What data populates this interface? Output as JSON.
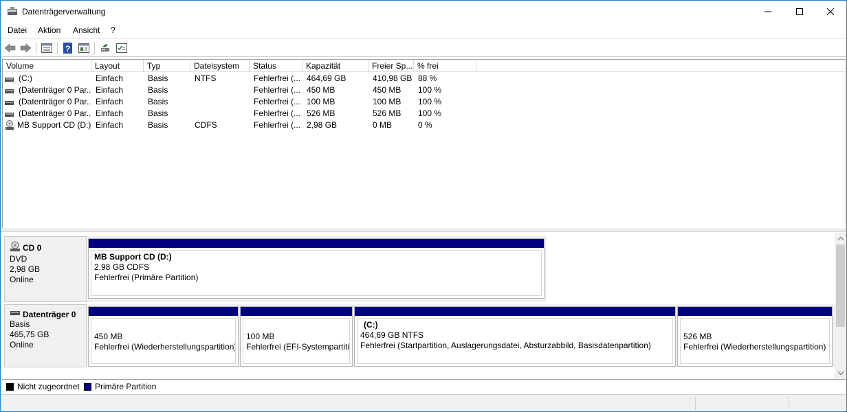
{
  "window": {
    "title": "Datenträgerverwaltung"
  },
  "menu": [
    "Datei",
    "Aktion",
    "Ansicht",
    "?"
  ],
  "toolbar": {
    "icons": [
      "back-icon",
      "forward-icon",
      "list-view-icon",
      "help-icon",
      "properties-icon",
      "rescan-icon",
      "disk-check-icon"
    ]
  },
  "list": {
    "columns": [
      "Volume",
      "Layout",
      "Typ",
      "Dateisystem",
      "Status",
      "Kapazität",
      "Freier Sp...",
      "% frei"
    ],
    "rows": [
      {
        "icon": "volume-icon",
        "cells": [
          "(C:)",
          "Einfach",
          "Basis",
          "NTFS",
          "Fehlerfrei (...",
          "464,69 GB",
          "410,98 GB",
          "88 %"
        ]
      },
      {
        "icon": "volume-icon",
        "cells": [
          "(Datenträger 0 Par...",
          "Einfach",
          "Basis",
          "",
          "Fehlerfrei (...",
          "450 MB",
          "450 MB",
          "100 %"
        ]
      },
      {
        "icon": "volume-icon",
        "cells": [
          "(Datenträger 0 Par...",
          "Einfach",
          "Basis",
          "",
          "Fehlerfrei (...",
          "100 MB",
          "100 MB",
          "100 %"
        ]
      },
      {
        "icon": "volume-icon",
        "cells": [
          "(Datenträger 0 Par...",
          "Einfach",
          "Basis",
          "",
          "Fehlerfrei (...",
          "526 MB",
          "526 MB",
          "100 %"
        ]
      },
      {
        "icon": "cd-drive-icon",
        "cells": [
          "MB Support CD (D:)",
          "Einfach",
          "Basis",
          "CDFS",
          "Fehlerfrei (...",
          "2,98 GB",
          "0 MB",
          "0 %"
        ]
      }
    ]
  },
  "disks": [
    {
      "name": "CD 0",
      "type": "DVD",
      "size": "2,98 GB",
      "state": "Online",
      "partitions": [
        {
          "title": "MB Support CD  (D:)",
          "line1": "2,98 GB CDFS",
          "line2": "Fehlerfrei (Primäre Partition)"
        }
      ]
    },
    {
      "name": "Datenträger 0",
      "type": "Basis",
      "size": "465,75 GB",
      "state": "Online",
      "partitions": [
        {
          "title": "",
          "line1": "450 MB",
          "line2": "Fehlerfrei (Wiederherstellungspartition)"
        },
        {
          "title": "",
          "line1": "100 MB",
          "line2": "Fehlerfrei (EFI-Systempartition)"
        },
        {
          "title": "(C:)",
          "line1": "464,69 GB NTFS",
          "line2": "Fehlerfrei (Startpartition, Auslagerungsdatei, Absturzabbild, Basisdatenpartition)"
        },
        {
          "title": "",
          "line1": "526 MB",
          "line2": "Fehlerfrei (Wiederherstellungspartition)"
        }
      ]
    }
  ],
  "legend": [
    {
      "label": "Nicht zugeordnet",
      "color": "#000000"
    },
    {
      "label": "Primäre Partition",
      "color": "#000080"
    }
  ],
  "colors": {
    "partition_bar": "#000080",
    "window_border": "#1883d7"
  }
}
